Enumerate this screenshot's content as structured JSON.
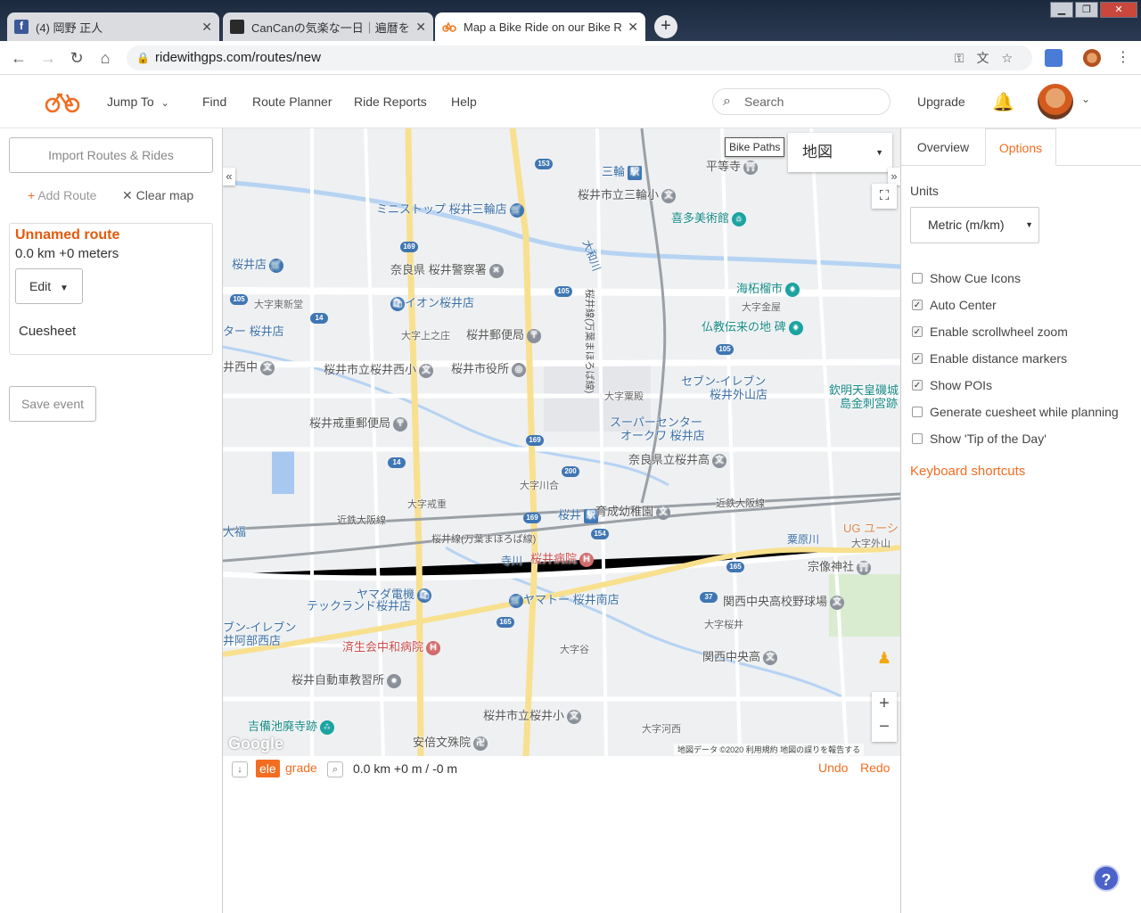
{
  "browser": {
    "tabs": [
      {
        "title": "(4) 岡野 正人",
        "favicon_color": "#3b5998"
      },
      {
        "title": "CanCanの気楽な一日｜遍暦を迎",
        "favicon_color": "#2a2a2a"
      },
      {
        "title": "Map a Bike Ride on our Bike R",
        "favicon_color": "#f07a24"
      }
    ],
    "close_glyph": "✕",
    "new_tab_glyph": "+",
    "url": "ridewithgps.com/routes/new",
    "window_buttons": [
      "▁",
      "❐",
      "✕"
    ]
  },
  "header": {
    "nav": [
      "Jump To",
      "Find",
      "Route Planner",
      "Ride Reports",
      "Help"
    ],
    "search_placeholder": "Search",
    "upgrade": "Upgrade",
    "brand_color": "#f36d21"
  },
  "left": {
    "import_button": "Import Routes & Rides",
    "add_route": "Add Route",
    "clear_map": "Clear map",
    "route_name": "Unnamed route",
    "route_stats": "0.0 km  +0 meters",
    "edit_button": "Edit",
    "cuesheet": "Cuesheet",
    "save_event": "Save event"
  },
  "map": {
    "bike_paths": "Bike Paths",
    "map_type": "地図",
    "labels": [
      "三輪",
      "平等寺",
      "桜井市立三輪小",
      "ミニストップ 桜井三輪店",
      "喜多美術館",
      "桜井店",
      "奈良県 桜井警察署",
      "海柘榴市",
      "イオン桜井店",
      "大字東新堂",
      "大字金屋",
      "ター 桜井店",
      "大字上之庄",
      "桜井郵便局",
      "仏教伝来の地 碑",
      "井西中",
      "桜井市立桜井西小",
      "桜井市役所",
      "セブン-イレブン",
      "桜井外山店",
      "欽明天皇磯城",
      "島金刺宮跡",
      "大字粟殿",
      "スーパーセンター",
      "オークワ 桜井店",
      "桜井戒重郵便局",
      "奈良県立桜井高",
      "大字川合",
      "大字戒重",
      "近鉄大阪線",
      "桜井",
      "育成幼稚園",
      "近鉄大阪線",
      "大福",
      "UG ユーシ",
      "桜井線(万葉まほろば線)",
      "粟原川",
      "大字外山",
      "寺川",
      "桜井病院",
      "宗像神社",
      "ヤマダ電機",
      "テックランド桜井店",
      "ヤマトー 桜井南店",
      "関西中央高校野球場",
      "ブン-イレブン",
      "井阿部西店",
      "大字桜井",
      "済生会中和病院",
      "大字谷",
      "関西中央高",
      "桜井自動車教習所",
      "吉備池廃寺跡",
      "桜井市立桜井小",
      "大字河西",
      "安倍文殊院",
      "大和川",
      "桜井線(万葉まほろば線)"
    ],
    "route_shields": [
      "153",
      "169",
      "105",
      "105",
      "14",
      "105",
      "169",
      "14",
      "200",
      "169",
      "154",
      "165",
      "37",
      "165"
    ],
    "copyright": "地図データ ©2020   利用規約   地図の誤りを報告する",
    "google": "Google",
    "zoom_in": "+",
    "zoom_out": "−"
  },
  "bottom": {
    "ele": "ele",
    "grade": "grade",
    "stats": "0.0 km +0 m / -0 m",
    "undo": "Undo",
    "redo": "Redo"
  },
  "right": {
    "tabs": [
      "Overview",
      "Options"
    ],
    "units_label": "Units",
    "units_value": "Metric (m/km)",
    "options": [
      {
        "label": "Show Cue Icons",
        "checked": false
      },
      {
        "label": "Auto Center",
        "checked": true
      },
      {
        "label": "Enable scrollwheel zoom",
        "checked": true
      },
      {
        "label": "Enable distance markers",
        "checked": true
      },
      {
        "label": "Show POIs",
        "checked": true
      },
      {
        "label": "Generate cuesheet while planning",
        "checked": false
      },
      {
        "label": "Show 'Tip of the Day'",
        "checked": false
      }
    ],
    "keyboard_shortcuts": "Keyboard shortcuts"
  },
  "help_glyph": "?"
}
